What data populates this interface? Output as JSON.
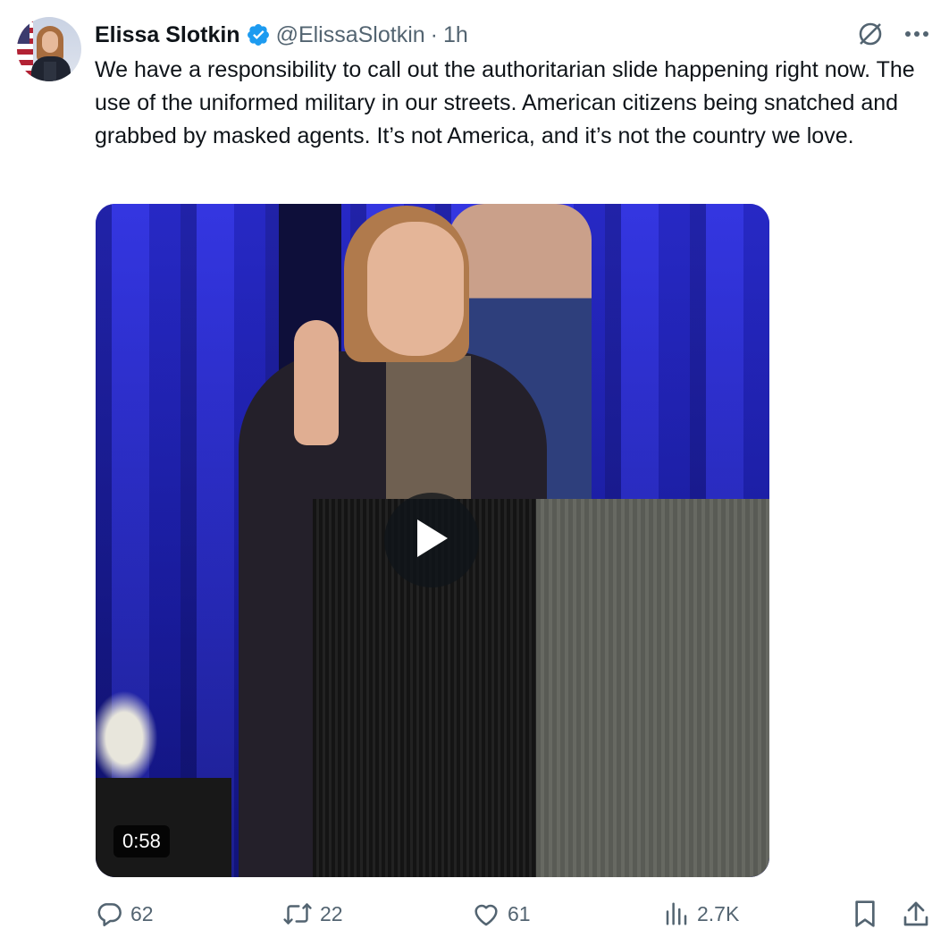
{
  "author": {
    "name": "Elissa Slotkin",
    "handle": "@ElissaSlotkin",
    "separator": "·",
    "time": "1h",
    "verified_color": "#1d9bf0"
  },
  "tweet": {
    "text": "We have a responsibility to call out the authoritarian slide happening right now. The use of the uniformed military in our streets. American citizens being snatched and grabbed by masked agents. It’s not America, and it’s not the country we love."
  },
  "media": {
    "duration": "0:58",
    "icons": [
      "play-icon"
    ]
  },
  "top_icons": [
    "grok-icon",
    "more-icon"
  ],
  "actions": {
    "replies": "62",
    "reposts": "22",
    "likes": "61",
    "views": "2.7K",
    "icons": [
      "reply-icon",
      "repost-icon",
      "like-icon",
      "views-icon",
      "bookmark-icon",
      "share-icon"
    ]
  },
  "colors": {
    "text": "#0f1419",
    "secondary": "#536471",
    "accent": "#1d9bf0"
  }
}
